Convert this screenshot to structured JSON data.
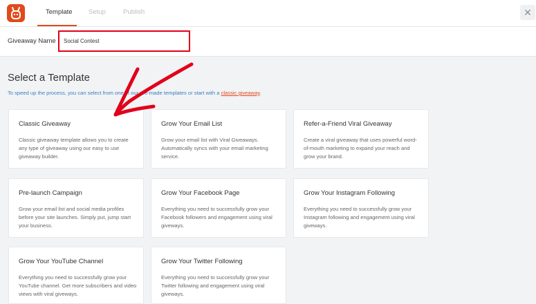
{
  "colors": {
    "accent": "#e04a1c",
    "highlight_box": "#e1001a",
    "annotation_arrow": "#e1001a"
  },
  "header": {
    "logo_icon": "rafflepress-logo-icon",
    "tabs": [
      {
        "label": "Template",
        "active": true
      },
      {
        "label": "Setup",
        "active": false
      },
      {
        "label": "Publish",
        "active": false
      }
    ],
    "close_icon": "close-icon",
    "close_glyph": "✕"
  },
  "giveaway": {
    "label": "Giveaway Name",
    "value": "Social Contest"
  },
  "templates": {
    "title": "Select a Template",
    "desc_before": "To speed up the process, you can select from one of our pre-made templates or start with a ",
    "desc_link": "classic giveaway",
    "desc_after": ".",
    "cards": [
      {
        "title": "Classic Giveaway",
        "desc": "Classic giveaway template allows you to create any type of giveaway using our easy to use giveaway builder."
      },
      {
        "title": "Grow Your Email List",
        "desc": "Grow your email list with Viral Giveaways. Automatically syncs with your email marketing service."
      },
      {
        "title": "Refer-a-Friend Viral Giveaway",
        "desc": "Create a viral giveaway that uses powerful word-of-mouth marketing to expand your reach and grow your brand."
      },
      {
        "title": "Pre-launch Campaign",
        "desc": "Grow your email list and social media profiles before your site launches. Simply put, jump start your business."
      },
      {
        "title": "Grow Your Facebook Page",
        "desc": "Everything you need to successfully grow your Facebook followers and engagement using viral giveways."
      },
      {
        "title": "Grow Your Instagram Following",
        "desc": "Everything you need to successfully grow your Instagram following and engagement using viral giveways."
      },
      {
        "title": "Grow Your YouTube Channel",
        "desc": "Everything you need to successfully grow your YouTube channel. Get more subscribers and video views with viral giveways."
      },
      {
        "title": "Grow Your Twitter Following",
        "desc": "Everything you need to successfully grow your Twitter following and engagement using viral giveways."
      }
    ]
  }
}
